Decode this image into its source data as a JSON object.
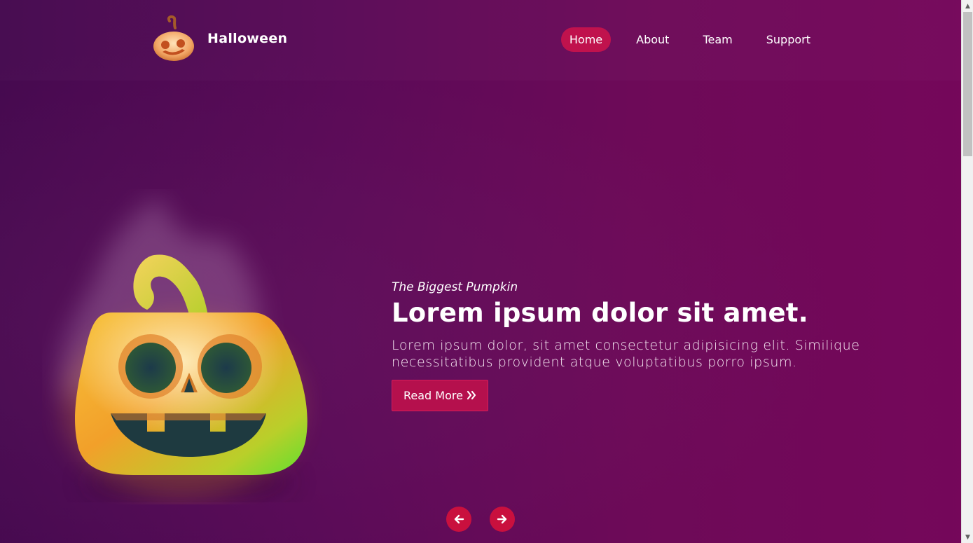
{
  "brand": {
    "name": "Halloween",
    "logo_icon": "pumpkin-icon"
  },
  "nav": {
    "items": [
      {
        "label": "Home",
        "active": true
      },
      {
        "label": "About",
        "active": false
      },
      {
        "label": "Team",
        "active": false
      },
      {
        "label": "Support",
        "active": false
      }
    ]
  },
  "hero": {
    "eyebrow": "The Biggest Pumpkin",
    "headline": "Lorem ipsum dolor sit amet.",
    "description": "Lorem ipsum dolor, sit amet consectetur adipisicing elit. Similique necessitatibus provident atque voluptatibus porro ipsum.",
    "cta_label": "Read More",
    "cta_icon": "double-chevron-right-icon",
    "image_icon": "jack-o-lantern-illustration"
  },
  "carousel": {
    "prev_icon": "arrow-left-icon",
    "next_icon": "arrow-right-icon"
  },
  "colors": {
    "accent": "#c0124d",
    "button": "#b5104d",
    "arrow": "#c9103e",
    "background_start": "#45094f",
    "background_end": "#75075a"
  },
  "scrollbar": {
    "up_glyph": "▲",
    "down_glyph": "▼"
  }
}
